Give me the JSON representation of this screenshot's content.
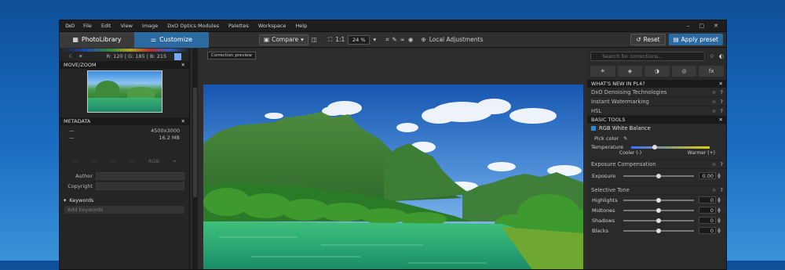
{
  "menubar": {
    "logo": "DxO",
    "items": [
      "File",
      "Edit",
      "View",
      "Image",
      "DxO Optics Modules",
      "Palettes",
      "Workspace",
      "Help"
    ],
    "window_controls": [
      "–",
      "▢",
      "✕"
    ]
  },
  "toolbar": {
    "photolibrary": "PhotoLibrary",
    "customize": "Customize",
    "compare": "Compare",
    "ratio": "1:1",
    "zoom": "24 %",
    "local_adjustments": "Local Adjustments",
    "reset": "Reset",
    "apply_preset": "Apply preset"
  },
  "left_panel": {
    "rgb_readout": "R: 120 | G: 185 | B: 215",
    "swatch_color": "#78aaf0",
    "move_zoom_title": "MOVE/ZOOM",
    "metadata_title": "METADATA",
    "metadata_rows": [
      {
        "key": "—",
        "value": "4500x3000"
      },
      {
        "key": "—",
        "value": "16.2 MB"
      }
    ],
    "exif_cells": [
      "—",
      "—",
      "—",
      "—",
      "RGB",
      "⌖"
    ],
    "author_label": "Author",
    "copyright_label": "Copyright",
    "keywords_title": "Keywords",
    "keywords_placeholder": "Add keywords"
  },
  "viewer": {
    "tooltip": "Correction preview"
  },
  "right_panel": {
    "search_placeholder": "Search for corrections...",
    "tab_icons": [
      "☀",
      "◈",
      "◑",
      "◎",
      "fx"
    ],
    "whats_new_title": "WHAT'S NEW IN PL4?",
    "whats_new_items": [
      "DxO Denoising Technologies",
      "Instant Watermarking",
      "HSL"
    ],
    "basic_tools_title": "BASIC TOOLS",
    "white_balance": {
      "title": "RGB White Balance",
      "pick_color": "Pick color",
      "temperature_label": "Temperature",
      "cooler": "Cooler (-)",
      "warmer": "Warmer (+)",
      "temperature_position": 0.3
    },
    "exposure": {
      "section": "Exposure Compensation",
      "label": "Exposure",
      "value": "0.00",
      "position": 0.5
    },
    "selective_tone": {
      "section": "Selective Tone",
      "rows": [
        {
          "label": "Highlights",
          "value": "0",
          "position": 0.5
        },
        {
          "label": "Midtones",
          "value": "0",
          "position": 0.5
        },
        {
          "label": "Shadows",
          "value": "0",
          "position": 0.5
        },
        {
          "label": "Blacks",
          "value": "0",
          "position": 0.5
        }
      ]
    }
  }
}
